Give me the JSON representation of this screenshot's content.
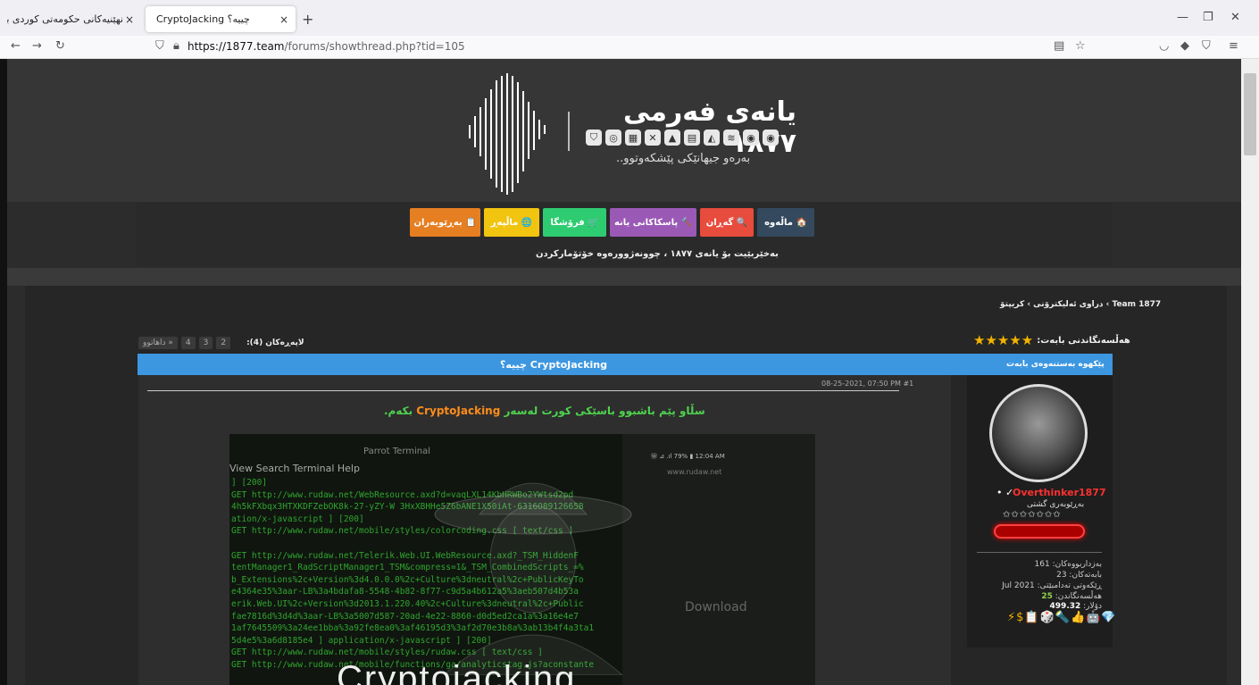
{
  "browser": {
    "tab1_title": "نهێنیەکانی حکومەتی کوردی بۆ دزین",
    "tab2_title": "CryptoJacking چییە؟",
    "new_tab": "+",
    "close_glyph": "×",
    "url_host": "https://1877.team",
    "url_path": "/forums/showthread.php?tid=105"
  },
  "header": {
    "logo_title": "یانەی فەرمی ١٨٧٧",
    "logo_tagline": "بەرەو جیهانێکی پێشکەوتوو..",
    "logo_icons": [
      "shield-icon",
      "globe-icon",
      "grid-icon",
      "tools-icon",
      "warning-icon",
      "server-icon",
      "linux-icon",
      "wifi-icon",
      "android-icon",
      "disk-icon"
    ]
  },
  "menu": {
    "home": "🏠 ماڵەوە",
    "search": "🔍 گەڕان",
    "tools": "🔨 پاسکاکانی یانە",
    "shop": "🛒 فرۆشگا",
    "website": "🌐 ماڵپەڕ",
    "admins": "📋 بەڕێوبەران"
  },
  "subnav": "بەخێربێیت بۆ یانەی ١٨٧٧ ، چوونەژوورەوە   خۆتۆمارکردن",
  "breadcrumb": "1877 Team › دراوی ئەلیکترۆنی › کریپتۆ",
  "rating": {
    "label": "هەڵسەنگاندنی بابەت:",
    "stars": "★★★★★"
  },
  "pagination": {
    "label": "لاپەڕەکان (4):",
    "pages": [
      "2",
      "3",
      "4"
    ],
    "next": "داهاتوو »"
  },
  "thread": {
    "title": "CryptoJacking چییە؟",
    "author_label": "پێکهوە بەستنەوەی بابەت"
  },
  "post": {
    "meta": "08-25-2021, 07:50 PM #1",
    "text_before": "سڵاو پێم باشبوو باسێکی کورت لەسەر ",
    "text_highlight": "CryptoJacking",
    "text_after": " بکەم."
  },
  "image": {
    "terminal_title": "Parrot Terminal",
    "menu": "View   Search   Terminal   Help",
    "status": "Ⓦ ⊿ .ıl 79% ▮ 12:04 AM",
    "url_hint": "www.rudaw.net",
    "download": "Download",
    "bottom_text": "Cryptojacking",
    "lines": [
      "] [200]",
      "GET http://www.rudaw.net/WebResource.axd?d=vaqLXL14KbHRWBo2YWtsd2pd",
      "4h5kFXbqx3HTXKDFZebOK8k-27-yZY-W 3HxXBHHe5Z6bANE1X50iAt-6316O8912665B",
      "ation/x-javascript ] [200]",
      "GET http://www.rudaw.net/mobile/styles/colorcoding.css [ text/css ]",
      "",
      "GET http://www.rudaw.net/Telerik.Web.UI.WebResource.axd?_TSM_HiddenF",
      "tentManager1_RadScriptManager1_TSM&compress=1&_TSM_CombinedScripts_=%",
      "b_Extensions%2c+Version%3d4.0.0.0%2c+Culture%3dneutral%2c+PublicKeyTo",
      "e4364e35%3aar-LB%3a4bdafa8-5548-4b82-8f77-c9d5a4b612a5%3aeb507d4b53a",
      "erik.Web.UI%2c+Version%3d2013.1.220.40%2c+Culture%3dneutral%2c+Public",
      "fae7816d%3d4d%3aar-LB%3a5007d587-20ad-4e22-8860-d0d5ed2ca1a%3a16e4e7",
      "1af7645509%3a24ee1bba%3a92fe8ea0%3af46195d3%3af2d70e3b8a%3ab13b4f4a3ta1",
      "5d4e5%3a6d8185e4 ] application/x-javascript ] [200]",
      "GET http://www.rudaw.net/mobile/styles/rudaw.css [ text/css ]",
      "GET http://www.rudaw.net/mobile/functions/ga/analyticstag.js?aconstante"
    ]
  },
  "profile": {
    "username": "Overthinker1877",
    "check": "• ✓",
    "title": "بەڕێوبەری گشتی",
    "stars": "✩✩✩✩✩✩✩",
    "threads": "بەزداربووەکان: 161",
    "posts": "بابەتەکان: 23",
    "joined": "ڕێکەوتی تەدامبێتی: 2021 Jul",
    "reputation_label": "هەڵسەنگاندن: ",
    "reputation_value": "25",
    "coins_label": "دۆلار: ",
    "coins_value": "499.32",
    "awards": "⚡$📋🎲🔦👍🤖💎"
  },
  "colors": {
    "thread_bar": "#3d97e0",
    "btn_home": "#34495e",
    "btn_search": "#e74c3c",
    "btn_tools": "#9b59b6",
    "btn_shop": "#2ecc71",
    "btn_site": "#f1c40f",
    "btn_admins": "#e67e22",
    "username": "#ff3030"
  }
}
